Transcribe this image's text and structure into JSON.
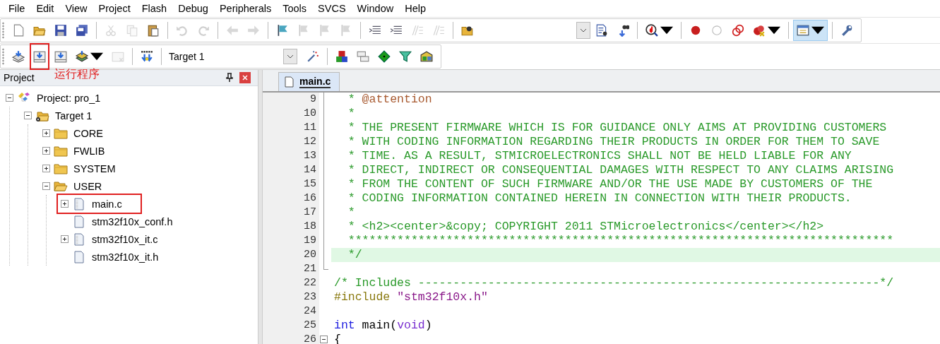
{
  "menu": [
    "File",
    "Edit",
    "View",
    "Project",
    "Flash",
    "Debug",
    "Peripherals",
    "Tools",
    "SVCS",
    "Window",
    "Help"
  ],
  "toolbar_1": [
    {
      "kind": "button",
      "disabled": false,
      "selected": false,
      "dropdown": false
    },
    {
      "kind": "button",
      "disabled": false,
      "selected": false,
      "dropdown": false
    },
    {
      "kind": "button",
      "disabled": false,
      "selected": false,
      "dropdown": false
    },
    {
      "kind": "button",
      "disabled": false,
      "selected": false,
      "dropdown": false
    },
    {
      "kind": "separator"
    },
    {
      "kind": "button",
      "disabled": true,
      "selected": false,
      "dropdown": false
    },
    {
      "kind": "button",
      "disabled": true,
      "selected": false,
      "dropdown": false
    },
    {
      "kind": "button",
      "disabled": false,
      "selected": false,
      "dropdown": false
    },
    {
      "kind": "separator"
    },
    {
      "kind": "button",
      "disabled": true,
      "selected": false,
      "dropdown": false
    },
    {
      "kind": "button",
      "disabled": true,
      "selected": false,
      "dropdown": false
    },
    {
      "kind": "separator"
    },
    {
      "kind": "button",
      "disabled": true,
      "selected": false,
      "dropdown": false
    },
    {
      "kind": "button",
      "disabled": true,
      "selected": false,
      "dropdown": false
    },
    {
      "kind": "separator"
    },
    {
      "kind": "button",
      "disabled": false,
      "selected": false,
      "dropdown": false
    },
    {
      "kind": "button",
      "disabled": true,
      "selected": false,
      "dropdown": false
    },
    {
      "kind": "button",
      "disabled": true,
      "selected": false,
      "dropdown": false
    },
    {
      "kind": "button",
      "disabled": true,
      "selected": false,
      "dropdown": false
    },
    {
      "kind": "separator"
    },
    {
      "kind": "button",
      "disabled": false,
      "selected": false,
      "dropdown": false
    },
    {
      "kind": "button",
      "disabled": false,
      "selected": false,
      "dropdown": false
    },
    {
      "kind": "button",
      "disabled": true,
      "selected": false,
      "dropdown": false
    },
    {
      "kind": "button",
      "disabled": true,
      "selected": false,
      "dropdown": false
    },
    {
      "kind": "separator"
    },
    {
      "kind": "button",
      "disabled": false,
      "selected": false,
      "dropdown": false
    },
    {
      "kind": "spacer"
    },
    {
      "kind": "combo"
    },
    {
      "kind": "button",
      "disabled": false,
      "selected": false,
      "dropdown": false
    },
    {
      "kind": "button",
      "disabled": false,
      "selected": false,
      "dropdown": false
    },
    {
      "kind": "separator"
    },
    {
      "kind": "button",
      "disabled": false,
      "selected": false,
      "dropdown": true
    },
    {
      "kind": "separator"
    },
    {
      "kind": "button",
      "disabled": false,
      "selected": false,
      "dropdown": false
    },
    {
      "kind": "button",
      "disabled": false,
      "selected": false,
      "dropdown": false
    },
    {
      "kind": "button",
      "disabled": false,
      "selected": false,
      "dropdown": false
    },
    {
      "kind": "button",
      "disabled": false,
      "selected": false,
      "dropdown": true
    },
    {
      "kind": "separator"
    },
    {
      "kind": "button",
      "disabled": false,
      "selected": true,
      "dropdown": true
    },
    {
      "kind": "separator"
    },
    {
      "kind": "button",
      "disabled": false,
      "selected": false,
      "dropdown": false
    }
  ],
  "toolbar_2": [
    {
      "kind": "button",
      "disabled": false,
      "annotated": false,
      "dropdown": false
    },
    {
      "kind": "button",
      "disabled": false,
      "annotated": true,
      "dropdown": false
    },
    {
      "kind": "button",
      "disabled": false,
      "annotated": false,
      "dropdown": false
    },
    {
      "kind": "button",
      "disabled": false,
      "annotated": false,
      "dropdown": true
    },
    {
      "kind": "button",
      "disabled": true,
      "annotated": false,
      "dropdown": false
    },
    {
      "kind": "separator"
    },
    {
      "kind": "button",
      "disabled": false,
      "annotated": false,
      "dropdown": false
    },
    {
      "kind": "separator"
    },
    {
      "kind": "combo",
      "value": "Target 1"
    },
    {
      "kind": "button",
      "disabled": false,
      "annotated": false,
      "dropdown": false
    },
    {
      "kind": "separator"
    },
    {
      "kind": "button",
      "disabled": false,
      "annotated": false,
      "dropdown": false
    },
    {
      "kind": "button",
      "disabled": false,
      "annotated": false,
      "dropdown": false
    },
    {
      "kind": "button",
      "disabled": false,
      "annotated": false,
      "dropdown": false
    },
    {
      "kind": "button",
      "disabled": false,
      "annotated": false,
      "dropdown": false
    },
    {
      "kind": "button",
      "disabled": false,
      "annotated": false,
      "dropdown": false
    }
  ],
  "project_panel": {
    "title": "Project",
    "callout": "运行程序",
    "tree": [
      {
        "label": "Project: pro_1",
        "kind": "project",
        "expanded": true,
        "annotated": false,
        "children": [
          {
            "label": "Target 1",
            "kind": "target",
            "expanded": true,
            "annotated": false,
            "children": [
              {
                "label": "CORE",
                "kind": "folder",
                "expanded": false,
                "annotated": false
              },
              {
                "label": "FWLIB",
                "kind": "folder",
                "expanded": false,
                "annotated": false
              },
              {
                "label": "SYSTEM",
                "kind": "folder",
                "expanded": false,
                "annotated": false
              },
              {
                "label": "USER",
                "kind": "folder",
                "expanded": true,
                "annotated": false,
                "children": [
                  {
                    "label": "main.c",
                    "kind": "source",
                    "expanded": false,
                    "annotated": true
                  },
                  {
                    "label": "stm32f10x_conf.h",
                    "kind": "header",
                    "annotated": false
                  },
                  {
                    "label": "stm32f10x_it.c",
                    "kind": "source",
                    "expanded": false,
                    "annotated": false
                  },
                  {
                    "label": "stm32f10x_it.h",
                    "kind": "header",
                    "annotated": false
                  }
                ]
              }
            ]
          }
        ]
      }
    ]
  },
  "editor": {
    "tabs": [
      {
        "label": "main.c",
        "selected": true
      }
    ],
    "lines": [
      {
        "number": "9",
        "kind": "fold_body",
        "highlighted": false,
        "segments": [
          {
            "kind": "comment",
            "text": "  * "
          },
          {
            "kind": "doc_tag",
            "text": "@attention"
          }
        ]
      },
      {
        "number": "10",
        "kind": "fold_body",
        "highlighted": false,
        "segments": [
          {
            "kind": "comment",
            "text": "  *"
          }
        ]
      },
      {
        "number": "11",
        "kind": "fold_body",
        "highlighted": false,
        "segments": [
          {
            "kind": "comment",
            "text": "  * THE PRESENT FIRMWARE WHICH IS FOR GUIDANCE ONLY AIMS AT PROVIDING CUSTOMERS"
          }
        ]
      },
      {
        "number": "12",
        "kind": "fold_body",
        "highlighted": false,
        "segments": [
          {
            "kind": "comment",
            "text": "  * WITH CODING INFORMATION REGARDING THEIR PRODUCTS IN ORDER FOR THEM TO SAVE"
          }
        ]
      },
      {
        "number": "13",
        "kind": "fold_body",
        "highlighted": false,
        "segments": [
          {
            "kind": "comment",
            "text": "  * TIME. AS A RESULT, STMICROELECTRONICS SHALL NOT BE HELD LIABLE FOR ANY"
          }
        ]
      },
      {
        "number": "14",
        "kind": "fold_body",
        "highlighted": false,
        "segments": [
          {
            "kind": "comment",
            "text": "  * DIRECT, INDIRECT OR CONSEQUENTIAL DAMAGES WITH RESPECT TO ANY CLAIMS ARISING"
          }
        ]
      },
      {
        "number": "15",
        "kind": "fold_body",
        "highlighted": false,
        "segments": [
          {
            "kind": "comment",
            "text": "  * FROM THE CONTENT OF SUCH FIRMWARE AND/OR THE USE MADE BY CUSTOMERS OF THE"
          }
        ]
      },
      {
        "number": "16",
        "kind": "fold_body",
        "highlighted": false,
        "segments": [
          {
            "kind": "comment",
            "text": "  * CODING INFORMATION CONTAINED HEREIN IN CONNECTION WITH THEIR PRODUCTS."
          }
        ]
      },
      {
        "number": "17",
        "kind": "fold_body",
        "highlighted": false,
        "segments": [
          {
            "kind": "comment",
            "text": "  *"
          }
        ]
      },
      {
        "number": "18",
        "kind": "fold_body",
        "highlighted": false,
        "segments": [
          {
            "kind": "comment",
            "text": "  * <h2><center>&copy; COPYRIGHT 2011 STMicroelectronics</center></h2>"
          }
        ]
      },
      {
        "number": "19",
        "kind": "fold_body",
        "highlighted": false,
        "segments": [
          {
            "kind": "comment",
            "text": "  ******************************************************************************"
          }
        ]
      },
      {
        "number": "20",
        "kind": "fold_body",
        "highlighted": true,
        "segments": [
          {
            "kind": "comment",
            "text": "  */"
          }
        ]
      },
      {
        "number": "21",
        "kind": "fold_end",
        "highlighted": false
      },
      {
        "number": "22",
        "kind": "plain",
        "highlighted": false,
        "segments": [
          {
            "kind": "comment",
            "text": "/* Includes ------------------------------------------------------------------*/"
          }
        ]
      },
      {
        "number": "23",
        "kind": "plain",
        "highlighted": false,
        "segments": [
          {
            "kind": "preprocessor",
            "text": "#include "
          },
          {
            "kind": "string",
            "text": "\"stm32f10x.h\""
          }
        ]
      },
      {
        "number": "24",
        "kind": "plain",
        "highlighted": false
      },
      {
        "number": "25",
        "kind": "plain",
        "highlighted": false,
        "segments": [
          {
            "kind": "keyword",
            "text": "int"
          },
          {
            "kind": "plain",
            "text": " main("
          },
          {
            "kind": "type",
            "text": "void"
          },
          {
            "kind": "plain",
            "text": ")"
          }
        ]
      },
      {
        "number": "26",
        "kind": "fold_start",
        "highlighted": false,
        "segments": [
          {
            "kind": "plain",
            "text": "{"
          }
        ]
      }
    ]
  }
}
